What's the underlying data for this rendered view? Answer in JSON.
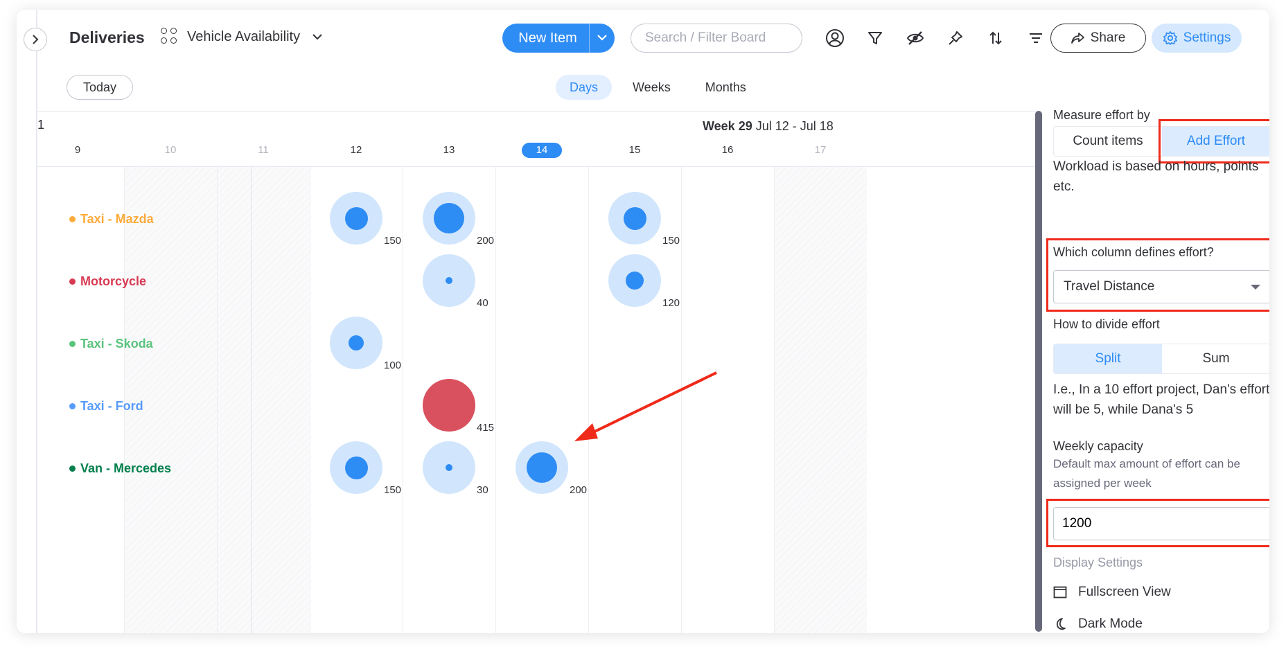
{
  "header": {
    "board_title": "Deliveries",
    "view_name": "Vehicle Availability",
    "new_item_label": "New Item",
    "search_placeholder": "Search / Filter Board",
    "share_label": "Share",
    "settings_label": "Settings"
  },
  "toolbar": {
    "today_label": "Today",
    "scales": [
      {
        "label": "Days",
        "active": true
      },
      {
        "label": "Weeks",
        "active": false
      },
      {
        "label": "Months",
        "active": false
      }
    ]
  },
  "timeline": {
    "prev_week_fragment": "1",
    "week_label": "Week 29",
    "week_range": "Jul 12 - Jul 18",
    "days": [
      "9",
      "10",
      "11",
      "12",
      "13",
      "14",
      "15",
      "16",
      "17"
    ],
    "weekend_days": [
      "10",
      "11",
      "17"
    ],
    "today": "14"
  },
  "rows": [
    {
      "name": "Taxi - Mazda",
      "color": "#fdab3d",
      "cells": [
        {
          "day": "12",
          "value": "150",
          "level": 0.5
        },
        {
          "day": "13",
          "value": "200",
          "level": 0.66
        },
        {
          "day": "15",
          "value": "150",
          "level": 0.5
        }
      ]
    },
    {
      "name": "Motorcycle",
      "color": "#d83a52",
      "cells": [
        {
          "day": "13",
          "value": "40",
          "level": 0.13
        },
        {
          "day": "15",
          "value": "120",
          "level": 0.4
        }
      ]
    },
    {
      "name": "Taxi - Skoda",
      "color": "#5ac47d",
      "cells": [
        {
          "day": "12",
          "value": "100",
          "level": 0.33
        }
      ]
    },
    {
      "name": "Taxi - Ford",
      "color": "#579bfc",
      "cells": [
        {
          "day": "13",
          "value": "415",
          "level": 1.0,
          "over": true
        }
      ]
    },
    {
      "name": "Van - Mercedes",
      "color": "#037f4c",
      "cells": [
        {
          "day": "12",
          "value": "150",
          "level": 0.5
        },
        {
          "day": "13",
          "value": "30",
          "level": 0.1
        },
        {
          "day": "14",
          "value": "200",
          "level": 0.66
        }
      ]
    }
  ],
  "panel": {
    "measure_title": "Measure effort by",
    "measure_options": [
      "Count items",
      "Add Effort"
    ],
    "measure_selected": "Add Effort",
    "measure_desc": "Workload is based on hours, points etc.",
    "column_question": "Which column defines effort?",
    "column_value": "Travel Distance",
    "divide_title": "How to divide effort",
    "divide_options": [
      "Split",
      "Sum"
    ],
    "divide_selected": "Split",
    "divide_desc": "I.e., In a 10 effort project, Dan's effort will be 5, while Dana's 5",
    "capacity_title": "Weekly capacity",
    "capacity_desc": "Default max amount of effort can be assigned per week",
    "capacity_value": "1200",
    "display_title": "Display Settings",
    "fullscreen_label": "Fullscreen View",
    "dark_mode_label": "Dark Mode"
  },
  "colors": {
    "accent": "#2e8cf5",
    "bubble_light": "#d1e6fc",
    "overload": "#d9515e",
    "highlight": "#ef2a1a"
  }
}
